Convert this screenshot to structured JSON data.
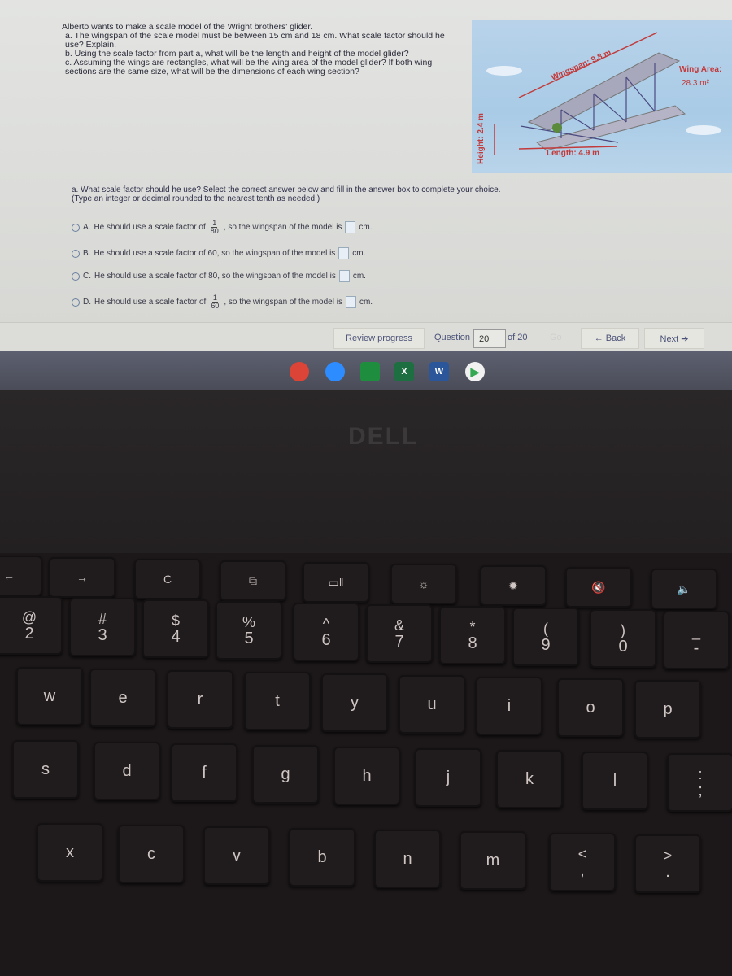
{
  "question": {
    "intro": "Alberto wants to make a scale model of the Wright brothers' glider.",
    "a": "a. The wingspan of the scale model must be between 15 cm and 18 cm. What scale factor should he use? Explain.",
    "b": "b. Using the scale factor from part a, what will be the length and height of the model glider?",
    "c": "c. Assuming the wings are rectangles, what will be the wing area of the model glider? If both wing sections are the same size, what will be the dimensions of each wing section?"
  },
  "figure": {
    "wingspan": "Wingspan: 9.8 m",
    "wing_area_label": "Wing Area:",
    "wing_area_value": "28.3 m²",
    "length": "Length: 4.9 m",
    "height": "Height: 2.4 m"
  },
  "part_a": {
    "prompt": "a. What scale factor should he use? Select the correct answer below and fill in the answer box to complete your choice.",
    "hint": "(Type an integer or decimal rounded to the nearest tenth as needed.)",
    "options": [
      {
        "letter": "A.",
        "pre": "He should use a scale factor of",
        "num": "1",
        "den": "80",
        "post": ", so the wingspan of the model is",
        "unit": "cm."
      },
      {
        "letter": "B.",
        "pre": "He should use a scale factor of 60, so the wingspan of the model is",
        "unit": "cm."
      },
      {
        "letter": "C.",
        "pre": "He should use a scale factor of 80, so the wingspan of the model is",
        "unit": "cm."
      },
      {
        "letter": "D.",
        "pre": "He should use a scale factor of",
        "num": "1",
        "den": "60",
        "post": ", so the wingspan of the model is",
        "unit": "cm."
      }
    ]
  },
  "nav": {
    "review": "Review progress",
    "question_label": "Question",
    "question_value": "20",
    "of_total": "of 20",
    "go": "Go",
    "back": "← Back",
    "next": "Next ➔"
  },
  "taskbar": {
    "apps": [
      {
        "icon": "chrome-icon",
        "color": "#db4437"
      },
      {
        "icon": "zoom-icon",
        "color": "#2d8cff"
      },
      {
        "icon": "google-classroom-icon",
        "color": "#1e8e3e"
      },
      {
        "icon": "excel-icon",
        "color": "#1d6f42",
        "glyph": "X"
      },
      {
        "icon": "word-icon",
        "color": "#2b579a",
        "glyph": "W"
      },
      {
        "icon": "play-store-icon",
        "color": "#f1f1f1"
      }
    ]
  },
  "brand": "DELL",
  "keyboard": {
    "rows": [
      [
        "←",
        "→",
        "C",
        "⧉",
        "▭‖",
        "☼",
        "✹",
        "🔇",
        "🔈"
      ],
      [
        [
          "@",
          "2"
        ],
        [
          "#",
          "3"
        ],
        [
          "$",
          "4"
        ],
        [
          "%",
          "5"
        ],
        [
          "^",
          "6"
        ],
        [
          "&",
          "7"
        ],
        [
          "*",
          "8"
        ],
        [
          "(",
          "9"
        ],
        [
          ")",
          "0"
        ],
        [
          "_",
          "-"
        ]
      ],
      [
        "w",
        "e",
        "r",
        "t",
        "y",
        "u",
        "i",
        "o",
        "p"
      ],
      [
        "s",
        "d",
        "f",
        "g",
        "h",
        "j",
        "k",
        "l",
        [
          ":",
          ";"
        ]
      ],
      [
        "x",
        "c",
        "v",
        "b",
        "n",
        "m",
        [
          "<",
          ","
        ],
        [
          ">",
          "."
        ]
      ]
    ]
  }
}
